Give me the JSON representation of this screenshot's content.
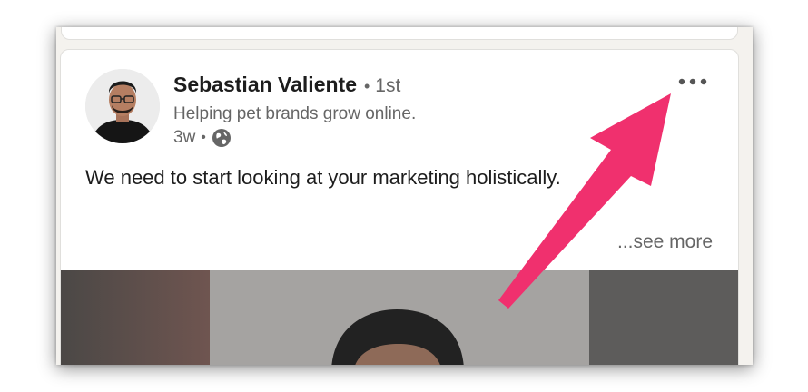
{
  "post": {
    "author_name": "Sebastian Valiente",
    "connection_separator": "•",
    "connection_degree": "1st",
    "headline": "Helping pet brands grow online.",
    "time_ago": "3w",
    "meta_separator": "•",
    "visibility_icon": "globe-icon",
    "text": "We need to start looking at your marketing holistically.",
    "see_more": "...see more",
    "more_icon": "ellipsis-icon"
  },
  "annotation": {
    "arrow_color": "#f0306e"
  }
}
